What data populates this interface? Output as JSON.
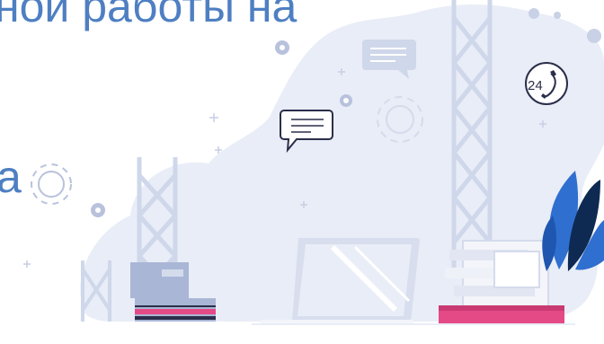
{
  "heading": {
    "line1": "ной работы на",
    "line2": "а"
  },
  "badge": {
    "hours": "24"
  },
  "colors": {
    "heading_text": "#4e7fc2",
    "blob": "#e9edf7",
    "tower": "#cfd7ea",
    "icon_stroke": "#b8c2dc",
    "dark_line": "#2b2e4a",
    "leaf_blue": "#2f6fd0",
    "leaf_dark": "#0e2a52",
    "pink": "#e44a86",
    "laptop": "#d8deee"
  },
  "icons": [
    "gear-icon",
    "chat-bubble-icon",
    "phone-24-icon",
    "sparkle-icon",
    "laptop-icon",
    "document-stack-icon",
    "book-stack-icon",
    "plant-icon"
  ]
}
